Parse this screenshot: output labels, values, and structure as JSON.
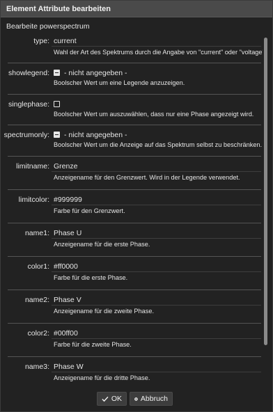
{
  "dialog": {
    "title": "Element Attribute bearbeiten",
    "subtitle": "Bearbeite powerspectrum"
  },
  "fields": [
    {
      "key": "type",
      "label": "type:",
      "kind": "text",
      "value": "current",
      "description": "Wahl der Art des Spektrums durch die Angabe von \"current\" oder \"voltage\"."
    },
    {
      "key": "showlegend",
      "label": "showlegend:",
      "kind": "checkbox",
      "state": "indeterminate",
      "value": "- nicht angegeben -",
      "description": "Boolscher Wert um eine Legende anzuzeigen."
    },
    {
      "key": "singlephase",
      "label": "singlephase:",
      "kind": "checkbox",
      "state": "unchecked",
      "value": "",
      "description": "Boolscher Wert um auszuwählen, dass nur eine Phase angezeigt wird."
    },
    {
      "key": "spectrumonly",
      "label": "spectrumonly:",
      "kind": "checkbox",
      "state": "indeterminate",
      "value": "- nicht angegeben -",
      "description": "Boolscher Wert um die Anzeige auf das Spektrum selbst zu beschränken."
    },
    {
      "key": "limitname",
      "label": "limitname:",
      "kind": "text",
      "value": "Grenze",
      "description": "Anzeigename für den Grenzwert. Wird in der Legende verwendet."
    },
    {
      "key": "limitcolor",
      "label": "limitcolor:",
      "kind": "text",
      "value": "#999999",
      "description": "Farbe für den Grenzwert."
    },
    {
      "key": "name1",
      "label": "name1:",
      "kind": "text",
      "value": "Phase U",
      "description": "Anzeigename für die erste Phase."
    },
    {
      "key": "color1",
      "label": "color1:",
      "kind": "text",
      "value": "#ff0000",
      "description": "Farbe für die erste Phase."
    },
    {
      "key": "name2",
      "label": "name2:",
      "kind": "text",
      "value": "Phase V",
      "description": "Anzeigename für die zweite Phase."
    },
    {
      "key": "color2",
      "label": "color2:",
      "kind": "text",
      "value": "#00ff00",
      "description": "Farbe für die zweite Phase."
    },
    {
      "key": "name3",
      "label": "name3:",
      "kind": "text",
      "value": "Phase W",
      "description": "Anzeigename für die dritte Phase."
    }
  ],
  "buttons": {
    "ok_label": "OK",
    "cancel_label": "Abbruch"
  },
  "icons": {
    "ok": "check-icon",
    "cancel": "close-circle-icon"
  },
  "colors": {
    "background": "#222222",
    "titlebar": "#4a4a4a",
    "text": "#e6e6e6"
  }
}
